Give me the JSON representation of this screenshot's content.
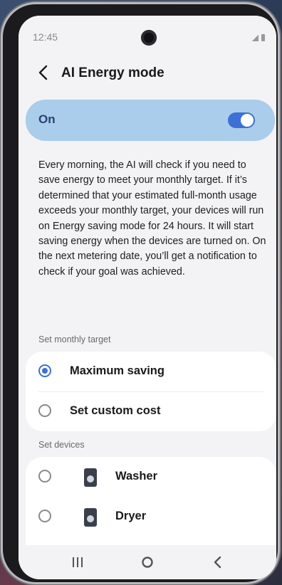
{
  "status_bar": {
    "time": "12:45"
  },
  "header": {
    "title": "AI Energy mode"
  },
  "toggle": {
    "label": "On",
    "state": true
  },
  "description": "Every morning, the AI will check if you need to save energy to meet your monthly target. If it’s determined that your estimated full-month usage exceeds your monthly target, your devices will run on Energy saving mode for 24 hours. It will start saving energy when the devices are turned on. On the next metering date, you’ll get a notification to check if your goal was achieved.",
  "monthly_target": {
    "section_label": "Set monthly target",
    "options": [
      {
        "label": "Maximum saving",
        "selected": true
      },
      {
        "label": "Set custom cost",
        "selected": false
      }
    ]
  },
  "devices": {
    "section_label": "Set devices",
    "items": [
      {
        "label": "Washer",
        "icon": "washer-icon",
        "selected": false
      },
      {
        "label": "Dryer",
        "icon": "dryer-icon",
        "selected": false
      }
    ]
  },
  "colors": {
    "accent": "#3d6fd6",
    "toggle_card": "#a9cdea",
    "toggle_text": "#2a4170"
  }
}
